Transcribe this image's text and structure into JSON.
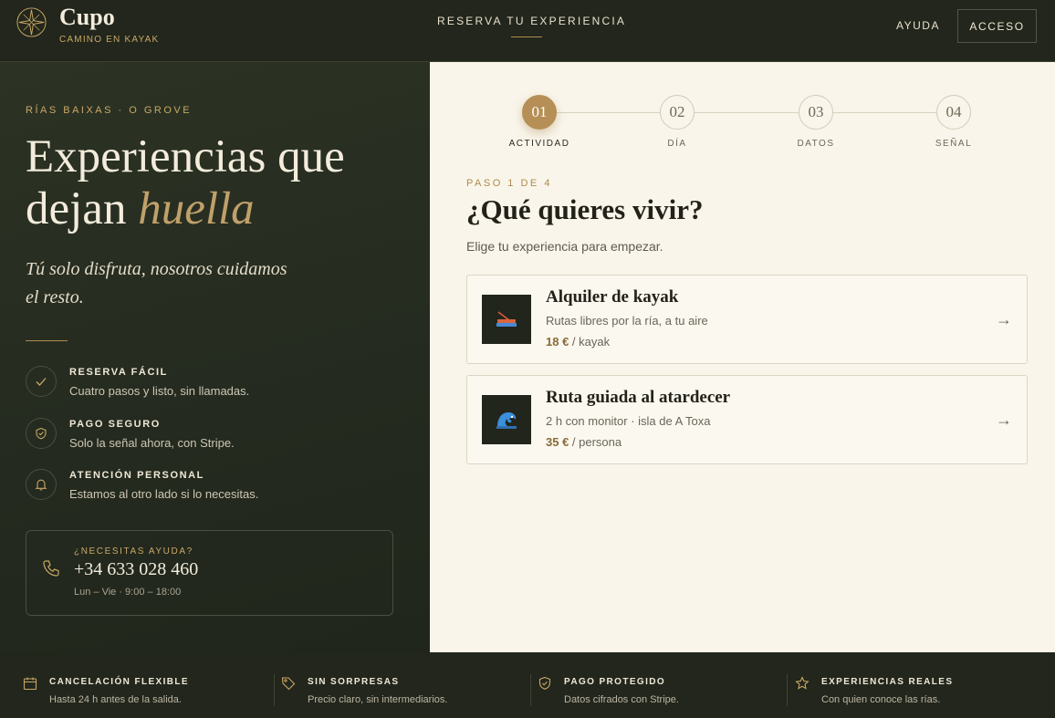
{
  "header": {
    "brand": "Cupo",
    "tagline": "CAMINO EN KAYAK",
    "nav_center": "RESERVA TU EXPERIENCIA",
    "help": "AYUDA",
    "login": "ACCESO"
  },
  "hero": {
    "kicker": "RÍAS BAIXAS · O GROVE",
    "title_line1": "Experiencias que",
    "title_line2_plain": "dejan ",
    "title_line2_em": "huella",
    "lede_line1": "Tú solo disfruta, nosotros cuidamos",
    "lede_line2": "el resto.",
    "features": [
      {
        "icon": "check-icon",
        "title": "RESERVA FÁCIL",
        "desc": "Cuatro pasos y listo, sin llamadas."
      },
      {
        "icon": "shield-icon",
        "title": "PAGO SEGURO",
        "desc": "Solo la señal ahora, con Stripe."
      },
      {
        "icon": "bell-icon",
        "title": "ATENCIÓN PERSONAL",
        "desc": "Estamos al otro lado si lo necesitas."
      }
    ],
    "help_box": {
      "kicker": "¿NECESITAS AYUDA?",
      "phone": "+34 633 028 460",
      "hours": "Lun – Vie · 9:00 – 18:00"
    }
  },
  "steps": [
    {
      "num": "01",
      "label": "ACTIVIDAD",
      "active": true
    },
    {
      "num": "02",
      "label": "DÍA",
      "active": false
    },
    {
      "num": "03",
      "label": "DATOS",
      "active": false
    },
    {
      "num": "04",
      "label": "SEÑAL",
      "active": false
    }
  ],
  "panel": {
    "step_kicker": "PASO 1 DE 4",
    "title": "¿Qué quieres vivir?",
    "subtitle": "Elige tu experiencia para empezar.",
    "cards": [
      {
        "icon": "kayak-icon",
        "title": "Alquiler de kayak",
        "desc": "Rutas libres por la ría, a tu aire",
        "price": "18 €",
        "unit": " / kayak",
        "arrow": "→"
      },
      {
        "icon": "wave-icon",
        "title": "Ruta guiada al atardecer",
        "desc": "2 h con monitor · isla de A Toxa",
        "price": "35 €",
        "unit": " / persona",
        "arrow": "→"
      }
    ]
  },
  "footer": [
    {
      "icon": "calendar-icon",
      "title": "CANCELACIÓN FLEXIBLE",
      "desc": "Hasta 24 h antes de la salida."
    },
    {
      "icon": "tag-icon",
      "title": "SIN SORPRESAS",
      "desc": "Precio claro, sin intermediarios."
    },
    {
      "icon": "shield-icon",
      "title": "PAGO PROTEGIDO",
      "desc": "Datos cifrados con Stripe."
    },
    {
      "icon": "star-icon",
      "title": "EXPERIENCIAS REALES",
      "desc": "Con quien conoce las rías."
    }
  ],
  "colors": {
    "accent": "#b58f56",
    "dark": "#22261c",
    "cream": "#f9f5ea"
  }
}
